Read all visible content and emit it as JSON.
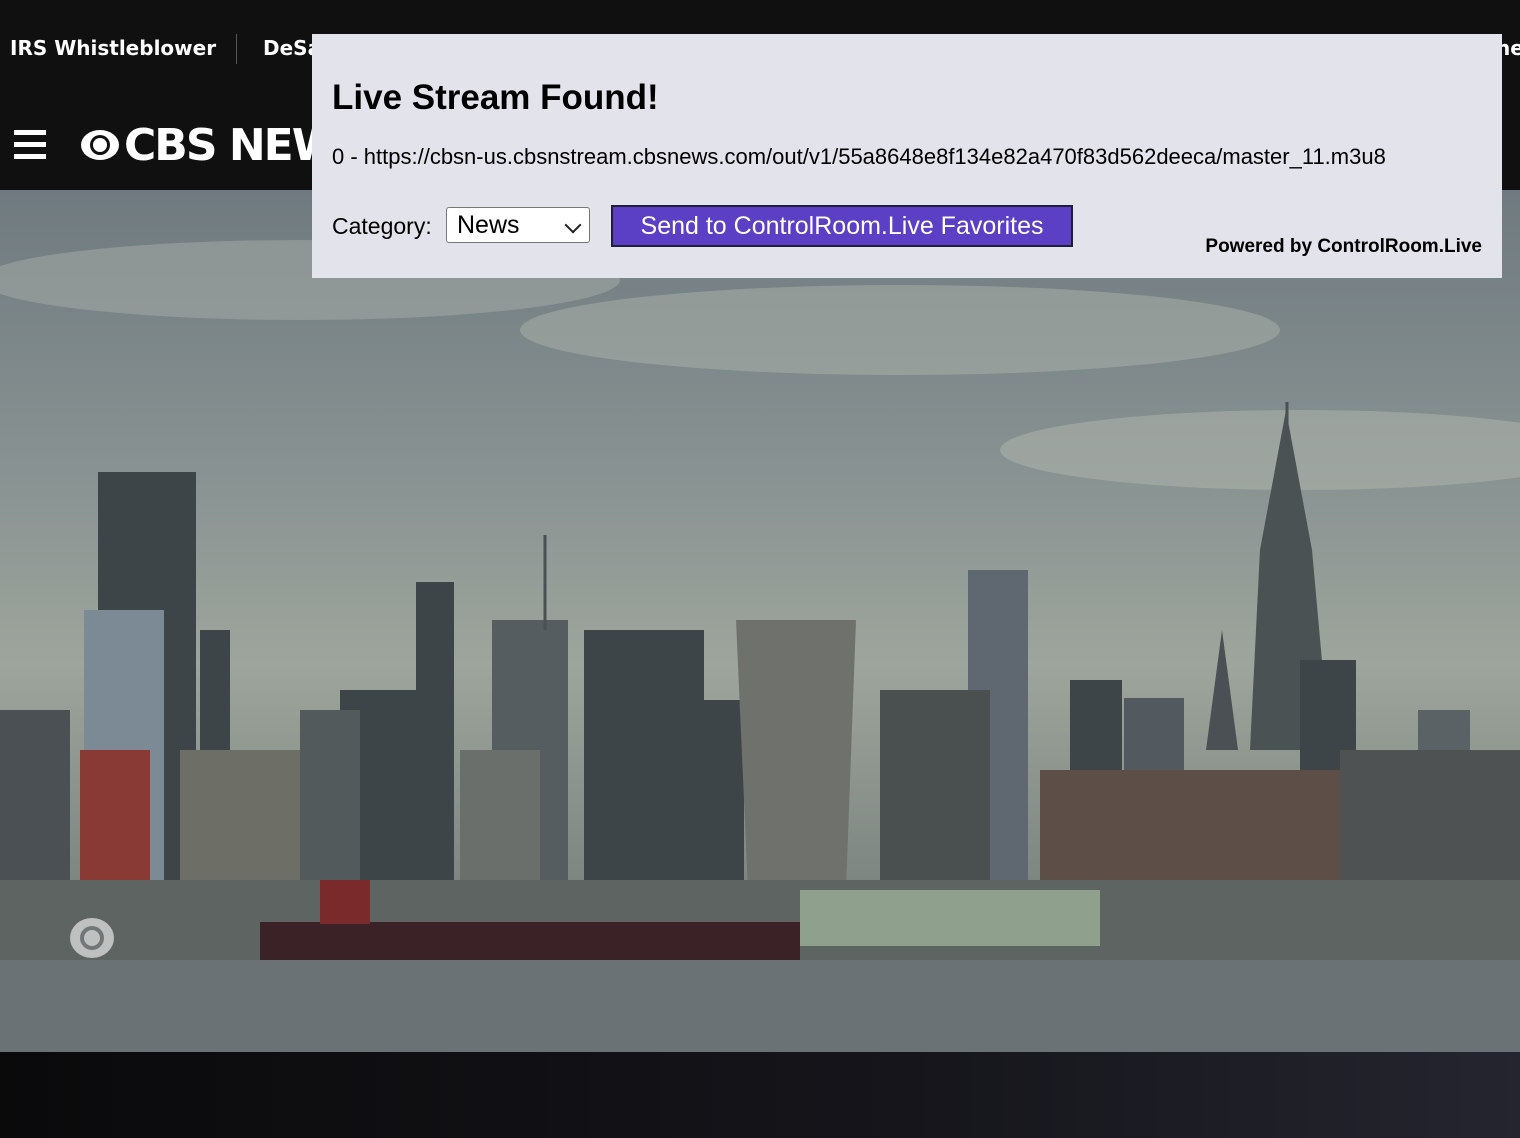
{
  "trending": {
    "items": [
      "IRS Whistleblower",
      "DeSa"
    ],
    "right_fragment": "he"
  },
  "nav": {
    "logo_text": "CBS NEW"
  },
  "popup": {
    "title": "Live Stream Found!",
    "stream_url": "0 - https://cbsn-us.cbsnstream.cbsnews.com/out/v1/55a8648e8f134e82a470f83d562deeca/master_11.m3u8",
    "category_label": "Category:",
    "category_value": "News",
    "send_button": "Send to ControlRoom.Live Favorites",
    "powered_by": "Powered by ControlRoom.Live"
  },
  "colors": {
    "button_bg": "#5b3fc4",
    "popup_bg": "#e3e3ec",
    "topbar_bg": "#101010"
  }
}
